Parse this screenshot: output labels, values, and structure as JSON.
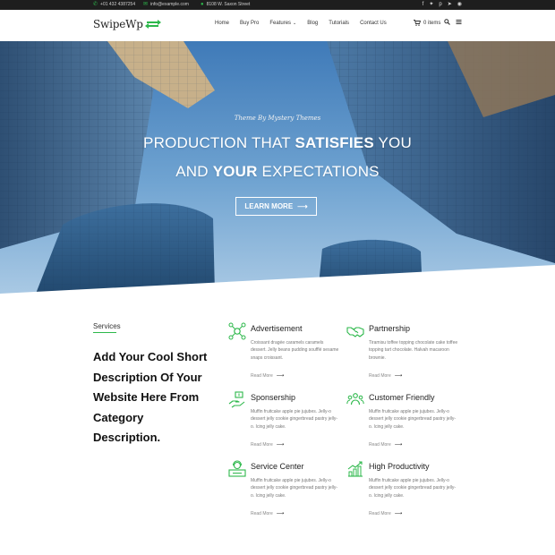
{
  "topbar": {
    "phone": "+01 432 4387254",
    "email": "info@example.com",
    "address": "8108 W. Saxon Street",
    "social_icons": [
      "facebook-icon",
      "twitter-icon",
      "pinterest-icon",
      "telegram-icon",
      "instagram-icon"
    ]
  },
  "header": {
    "logo": "SwipeWp",
    "nav": {
      "home": "Home",
      "buy_pro": "Buy Pro",
      "features": "Features",
      "blog": "Blog",
      "tutorials": "Tutorials",
      "contact": "Contact Us"
    },
    "cart": "0 items"
  },
  "hero": {
    "subtitle": "Theme By Mystery Themes",
    "line1_a": "PRODUCTION THAT ",
    "line1_b": "SATISFIES",
    "line1_c": " YOU",
    "line2_a": "AND ",
    "line2_b": "YOUR",
    "line2_c": " EXPECTATIONS",
    "button": "LEARN MORE"
  },
  "services": {
    "label": "Services",
    "description": "Add Your Cool Short Description Of Your Website Here From Category Description.",
    "read_more": "Read More",
    "items": [
      {
        "title": "Advertisement",
        "text": "Croissant dragée caramels caramels dessert. Jelly beans pudding soufflé sesame snaps croissant.",
        "icon": "advertisement-icon"
      },
      {
        "title": "Partnership",
        "text": "Tiramisu toffee topping chocolate cake toffee topping tart chocolate. Halvah macaroon brownie.",
        "icon": "handshake-icon"
      },
      {
        "title": "Sponsership",
        "text": "Muffin fruitcake apple pie jujubes. Jelly-o dessert jelly cookie gingerbread pastry jelly-o. Icing jelly cake.",
        "icon": "sponsorship-icon"
      },
      {
        "title": "Customer Friendly",
        "text": "Muffin fruitcake apple pie jujubes. Jelly-o dessert jelly cookie gingerbread pastry jelly-o. Icing jelly cake.",
        "icon": "customers-icon"
      },
      {
        "title": "Service Center",
        "text": "Muffin fruitcake apple pie jujubes. Jelly-o dessert jelly cookie gingerbread pastry jelly-o. Icing jelly cake.",
        "icon": "service-center-icon"
      },
      {
        "title": "High Productivity",
        "text": "Muffin fruitcake apple pie jujubes. Jelly-o dessert jelly cookie gingerbread pastry jelly-o. Icing jelly cake.",
        "icon": "growth-chart-icon"
      }
    ]
  },
  "colors": {
    "accent": "#2db84b",
    "topbar": "#1e1e1e",
    "sky": "#5b93c6"
  }
}
